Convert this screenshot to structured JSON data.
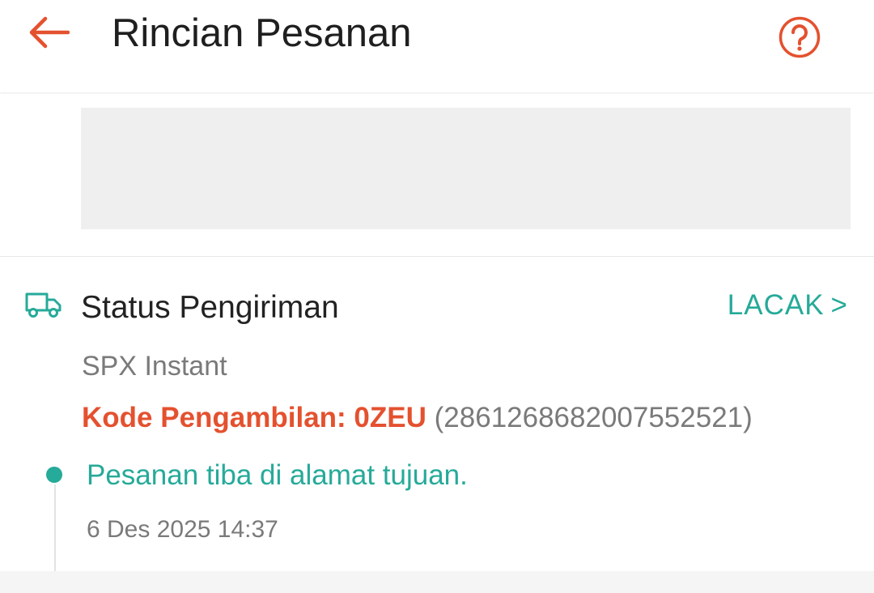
{
  "header": {
    "title": "Rincian Pesanan",
    "back_icon": "arrow-left-icon",
    "help_icon": "question-circle-icon"
  },
  "shipping": {
    "icon": "truck-icon",
    "title": "Status Pengiriman",
    "track_label": "LACAK",
    "track_chevron": ">",
    "courier": "SPX Instant",
    "pickup_label": "Kode Pengambilan: 0ZEU",
    "tracking_number": "(2861268682007552521)",
    "latest_event": {
      "text": "Pesanan tiba di alamat tujuan.",
      "time": "6 Des 2025 14:37"
    }
  },
  "colors": {
    "accent": "#ee4d2d",
    "teal": "#26aa99",
    "muted_text": "#7a7a7a"
  }
}
